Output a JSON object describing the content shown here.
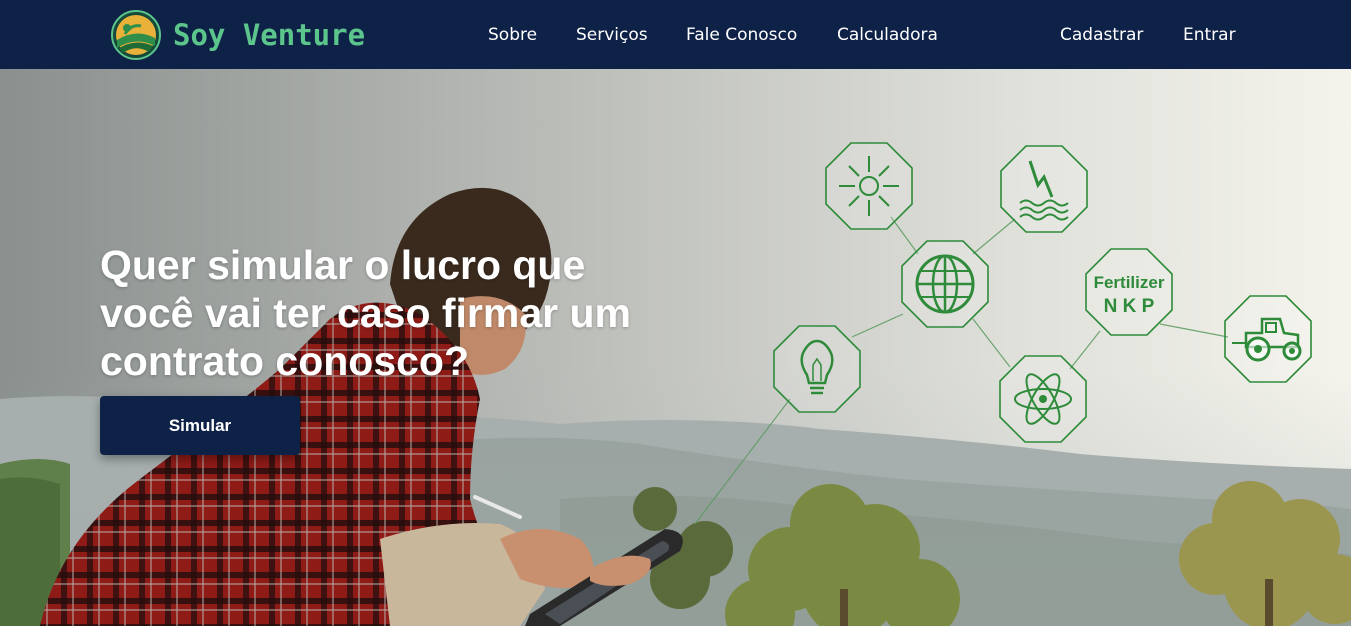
{
  "brand": {
    "name": "Soy Venture"
  },
  "nav": {
    "links": [
      "Sobre",
      "Serviços",
      "Fale Conosco",
      "Calculadora"
    ],
    "auth": [
      "Cadastrar",
      "Entrar"
    ]
  },
  "hero": {
    "headline": "Quer simular o lucro que você vai ter caso firmar um contrato conosco?",
    "cta_label": "Simular",
    "fertilizer": {
      "title": "Fertilizer",
      "letters": "N K P"
    }
  },
  "colors": {
    "navbar": "#0e2147",
    "brand": "#5cc58c",
    "icon_green": "#2e8b3a"
  },
  "icons": [
    "sun-icon",
    "lightning-water-icon",
    "globe-icon",
    "fertilizer-npk-icon",
    "lightbulb-icon",
    "atom-icon",
    "tractor-icon"
  ]
}
